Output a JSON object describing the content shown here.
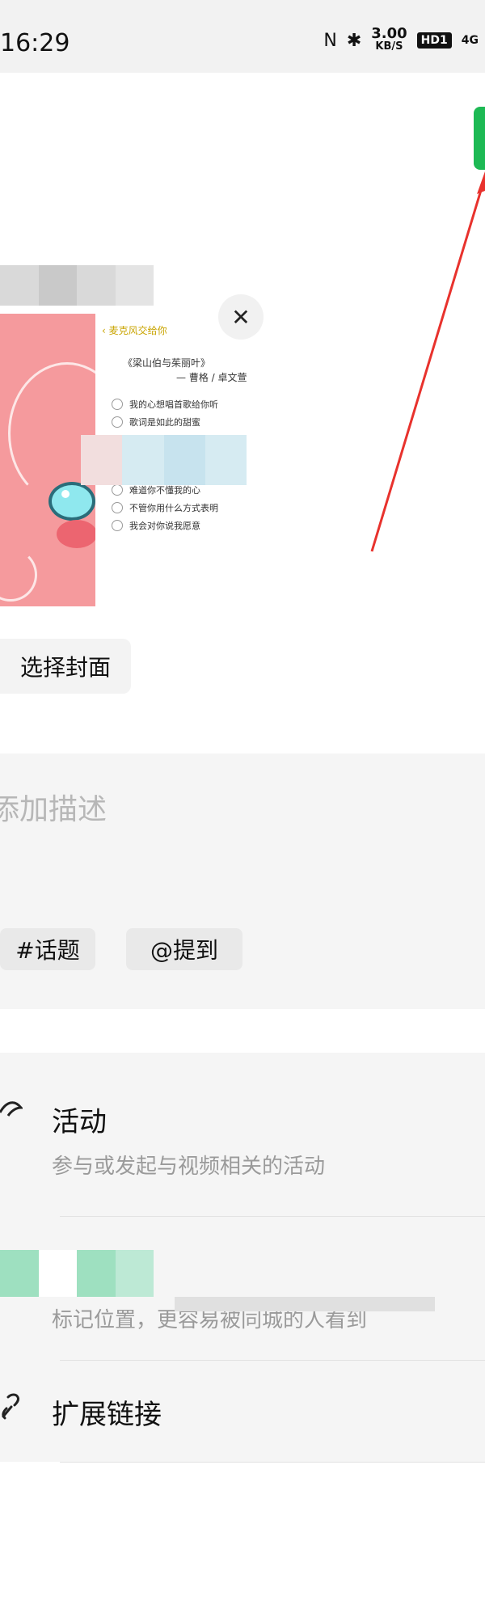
{
  "status_bar": {
    "time": "16:29",
    "nfc_icon": "N",
    "bluetooth_icon": "✱",
    "speed_value": "3.00",
    "speed_unit": "KB/S",
    "hd_label": "HD1",
    "network": "4G"
  },
  "cover": {
    "back_label": "麦克风交给你",
    "song_title": "《梁山伯与茱丽叶》",
    "song_artist": "— 曹格 / 卓文萱",
    "options": [
      "我的心想唱首歌给你听",
      "歌词是如此的甜蜜",
      "难道你不懂我的心",
      "不管你用什么方式表明",
      "我会对你说我愿意"
    ],
    "close_symbol": "✕",
    "choose_cover_label": "选择封面"
  },
  "description": {
    "placeholder": "添加描述",
    "topic_label": "#话题",
    "mention_label": "@提到"
  },
  "options": {
    "activity_title": "活动",
    "activity_subtitle": "参与或发起与视频相关的活动",
    "location_subtitle": "标记位置，更容易被同城的人看到",
    "link_title": "扩展链接"
  },
  "colors": {
    "publish_green": "#1db954",
    "arrow_red": "#e8322d",
    "cover_pink": "#f59a9d"
  }
}
